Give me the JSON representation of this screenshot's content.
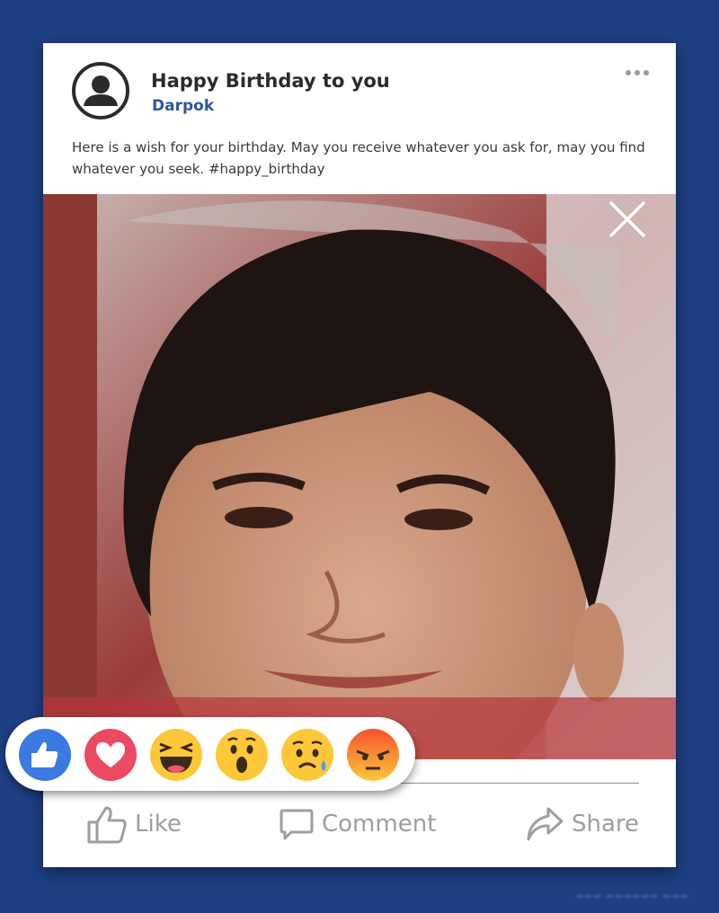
{
  "post": {
    "title": "Happy Birthday to you",
    "author": "Darpok",
    "caption": "Here is a wish for your birthday. May you receive whatever you ask for, may you find whatever you seek. #happy_birthday"
  },
  "icons": {
    "avatar": "user-avatar-icon",
    "more": "more-options-icon",
    "close": "close-icon",
    "like": "thumbs-up-icon",
    "comment": "comment-bubble-icon",
    "share": "share-arrow-icon"
  },
  "reactions": [
    "like",
    "love",
    "haha",
    "wow",
    "sad",
    "angry"
  ],
  "actions": {
    "like_label": "Like",
    "comment_label": "Comment",
    "share_label": "Share"
  },
  "colors": {
    "background": "#1e3f84",
    "author": "#2e55a3",
    "like_reaction": "#3b7ae0",
    "love_reaction": "#ec4a62",
    "emoji_yellow": "#fcc83a",
    "angry_red": "#f4522d"
  }
}
